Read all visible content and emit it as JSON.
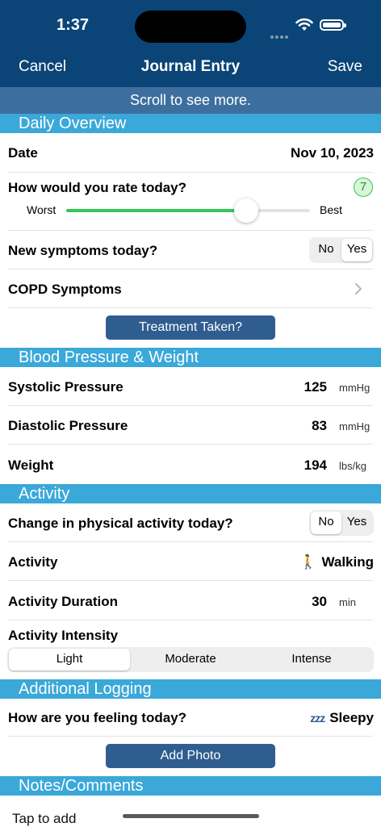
{
  "status": {
    "time": "1:37"
  },
  "nav": {
    "cancel": "Cancel",
    "title": "Journal Entry",
    "save": "Save"
  },
  "hint": "Scroll to see more.",
  "daily": {
    "header": "Daily Overview",
    "date_label": "Date",
    "date_value": "Nov 10, 2023",
    "rate_label": "How would you rate today?",
    "rate_value": "7",
    "rate_fraction": 0.74,
    "slider_min": "Worst",
    "slider_max": "Best",
    "symptoms_label": "New symptoms today?",
    "symptoms_options": [
      "No",
      "Yes"
    ],
    "symptoms_selected": "Yes",
    "copd_label": "COPD Symptoms",
    "treatment_button": "Treatment Taken?"
  },
  "bp": {
    "header": "Blood Pressure & Weight",
    "systolic_label": "Systolic Pressure",
    "systolic_value": "125",
    "systolic_unit": "mmHg",
    "diastolic_label": "Diastolic Pressure",
    "diastolic_value": "83",
    "diastolic_unit": "mmHg",
    "weight_label": "Weight",
    "weight_value": "194",
    "weight_unit": "lbs/kg"
  },
  "activity": {
    "header": "Activity",
    "change_label": "Change in physical activity today?",
    "change_options": [
      "No",
      "Yes"
    ],
    "change_selected": "No",
    "activity_label": "Activity",
    "activity_emoji": "🚶",
    "activity_value": "Walking",
    "duration_label": "Activity Duration",
    "duration_value": "30",
    "duration_unit": "min",
    "intensity_label": "Activity Intensity",
    "intensity_options": [
      "Light",
      "Moderate",
      "Intense"
    ],
    "intensity_selected": "Light"
  },
  "logging": {
    "header": "Additional Logging",
    "feeling_label": "How are you feeling today?",
    "feeling_icon": "zzz",
    "feeling_value": "Sleepy",
    "photo_button": "Add Photo"
  },
  "notes": {
    "header": "Notes/Comments",
    "placeholder": "Tap to add"
  },
  "colors": {
    "nav": "#0b4577",
    "section": "#3aa8d8",
    "button": "#2f5d8f",
    "slider": "#34c759"
  }
}
